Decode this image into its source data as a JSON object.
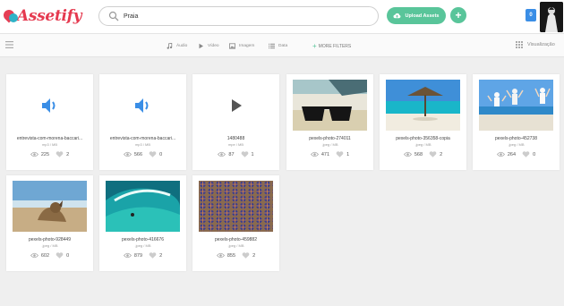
{
  "app": {
    "logo_text": "Assetify"
  },
  "search": {
    "value": "Praia"
  },
  "header": {
    "upload_label": "Upload Assets",
    "add_label": "+",
    "notification_count": "0"
  },
  "filters": {
    "audio": "Áudio",
    "video": "Vídeo",
    "image": "Imagem",
    "data": "Data",
    "more": "MORE FILTERS",
    "visualization": "Visualização"
  },
  "assets": [
    {
      "name": "entrevista-com-morena-baccari...",
      "meta": "mp3 / MB",
      "views": "225",
      "likes": "2"
    },
    {
      "name": "entrevista-com-morena-baccari...",
      "meta": "mp3 / MB",
      "views": "566",
      "likes": "0"
    },
    {
      "name": "1480488",
      "meta": "mpe / MB",
      "views": "87",
      "likes": "1"
    },
    {
      "name": "pexels-photo-274011",
      "meta": ".jpeg / MB",
      "views": "471",
      "likes": "1"
    },
    {
      "name": "pexels-photo-356358-copia",
      "meta": ".jpeg / MB",
      "views": "568",
      "likes": "2"
    },
    {
      "name": "pexels-photo-452738",
      "meta": ".jpeg / MB",
      "views": "264",
      "likes": "0"
    },
    {
      "name": "pexels-photo-928449",
      "meta": ".jpeg / MB",
      "views": "602",
      "likes": "0"
    },
    {
      "name": "pexels-photo-416676",
      "meta": ".jpeg / MB",
      "views": "879",
      "likes": "2"
    },
    {
      "name": "pexels-photo-459882",
      "meta": ".jpeg / MB",
      "views": "855",
      "likes": "2"
    }
  ],
  "colors": {
    "accent": "#59c59a",
    "brand": "#e5394f",
    "badge": "#3a8ee6",
    "icon_blue": "#3a8ee6"
  }
}
